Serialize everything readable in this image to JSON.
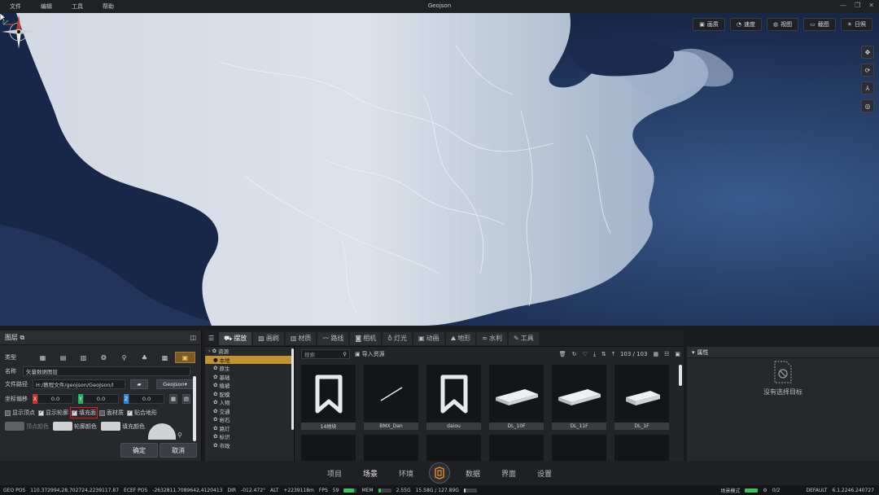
{
  "menu": {
    "items": [
      "文件",
      "编辑",
      "工具",
      "帮助"
    ],
    "title": "Geojson"
  },
  "viewport": {
    "view_buttons": [
      {
        "label": "画质",
        "icon": "image-icon"
      },
      {
        "label": "速度",
        "icon": "gauge-icon"
      },
      {
        "label": "视图",
        "icon": "globe-icon"
      },
      {
        "label": "截图",
        "icon": "screenshot-icon"
      },
      {
        "label": "日照",
        "icon": "sun-icon"
      }
    ],
    "side_tools": [
      "move-icon",
      "orbit-icon",
      "axis-icon",
      "globe-layer-icon"
    ]
  },
  "layer_panel": {
    "title": "图层",
    "type_label": "类型",
    "name_label": "名称",
    "name_value": "矢量数据图层",
    "path_label": "文件路径",
    "path_value": "H:/教程文件/geojson/GeoJson/l",
    "format_value": "GeoJson",
    "offset_label": "坐标偏移",
    "offset": {
      "x_tag": "X",
      "x": "0.0",
      "y_tag": "Y",
      "y": "0.0",
      "z_tag": "Z",
      "z": "0.0"
    },
    "checks": [
      {
        "label": "显示顶点",
        "checked": false
      },
      {
        "label": "显示轮廓",
        "checked": true
      },
      {
        "label": "填充面",
        "checked": true
      },
      {
        "label": "面材质",
        "checked": false
      },
      {
        "label": "贴合地形",
        "checked": true
      }
    ],
    "colors": {
      "vertex": "顶点颜色",
      "outline": "轮廓颜色",
      "fill": "填充颜色"
    },
    "confirm": "确定",
    "cancel": "取消"
  },
  "res_panel": {
    "tabs": [
      {
        "label": "摆放",
        "icon": "car-icon",
        "active": true
      },
      {
        "label": "画刷",
        "icon": "brush-icon",
        "active": false
      },
      {
        "label": "材质",
        "icon": "material-icon",
        "active": false
      },
      {
        "label": "路线",
        "icon": "route-icon",
        "active": false
      },
      {
        "label": "相机",
        "icon": "camera-icon",
        "active": false
      },
      {
        "label": "灯光",
        "icon": "light-icon",
        "active": false
      },
      {
        "label": "动画",
        "icon": "animation-icon",
        "active": false
      },
      {
        "label": "地形",
        "icon": "terrain-icon",
        "active": false
      },
      {
        "label": "水利",
        "icon": "water-icon",
        "active": false
      },
      {
        "label": "工具",
        "icon": "wrench-icon",
        "active": false
      }
    ],
    "tree_root": "资源",
    "tree_items": [
      "本地",
      "原生",
      "基础",
      "植被",
      "配模",
      "人物",
      "交通",
      "岩石",
      "路灯",
      "标识",
      "市政"
    ],
    "search_placeholder": "搜索",
    "import_label": "导入资源",
    "count": "103 / 103",
    "assets": [
      {
        "name": "14地块",
        "thumb": "bookmark"
      },
      {
        "name": "BMX_Dan",
        "thumb": "line"
      },
      {
        "name": "daiou",
        "thumb": "bookmark"
      },
      {
        "name": "DL_10F",
        "thumb": "building"
      },
      {
        "name": "DL_11F",
        "thumb": "building"
      },
      {
        "name": "DL_1F",
        "thumb": "building-small"
      }
    ]
  },
  "prop_panel": {
    "title": "属性",
    "empty": "没有选择目标"
  },
  "bottom_nav": {
    "left": [
      "项目",
      "场景",
      "环境"
    ],
    "right": [
      "数据",
      "界面",
      "设置"
    ],
    "active": "场景"
  },
  "status": {
    "geo_label": "GEO POS",
    "geo": "110.372994,28.702724,2239117.87",
    "ecef_label": "ECEF POS",
    "ecef": "-2632811.7089642,4120413",
    "dir_label": "DIR",
    "dir": "-012.472°",
    "alt_label": "ALT",
    "alt": "+2239118m",
    "fps_label": "FPS",
    "fps": "59",
    "mem_label": "MEM",
    "mem": "2.55G",
    "gpu": "15.58G / 127.89G",
    "scene_mode": "场景模式",
    "ratio": "0/2",
    "profile": "DEFAULT",
    "version": "6.1.2246.240727"
  }
}
